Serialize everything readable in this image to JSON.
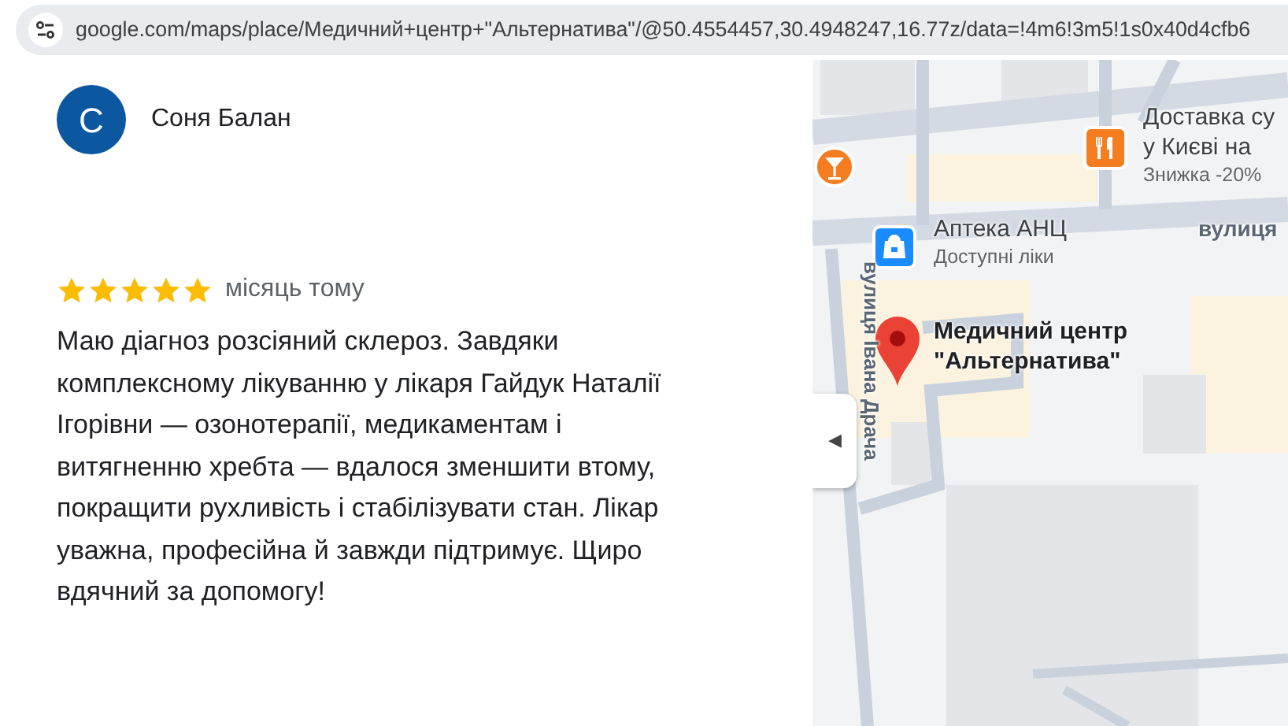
{
  "address_bar": {
    "url": "google.com/maps/place/Медичний+центр+\"Альтернатива\"/@50.4554457,30.4948247,16.77z/data=!4m6!3m5!1s0x40d4cfb6"
  },
  "review": {
    "author": {
      "initial": "С",
      "name": "Соня Балан"
    },
    "stars": 5,
    "time": "місяць тому",
    "text": "Маю діагноз розсіяний склероз. Завдяки комплексному лікуванню у лікаря Гайдук Наталії Ігорівни — озонотерапії, медикаментам і витягненню хребта — вдалося зменшити втому, покращити рухливість і стабілізувати стан. Лікар уважна, професійна й завжди підтримує. Щиро вдячний за допомогу!"
  },
  "map": {
    "markers": [
      {
        "kind": "bar"
      },
      {
        "kind": "restaurant",
        "title_lines": [
          "Доставка су",
          "у Києві на"
        ],
        "subtitle": "Знижка -20%"
      },
      {
        "kind": "pharmacy",
        "title_lines": [
          "Аптека АНЦ"
        ],
        "subtitle": "Доступні ліки"
      },
      {
        "kind": "place",
        "title_lines": [
          "Медичний центр",
          "\"Альтернатива\""
        ]
      }
    ],
    "streets": [
      {
        "kind": "horizontal",
        "label": "вулиця"
      },
      {
        "kind": "vertical",
        "label": "вулиця Івана Драча"
      }
    ],
    "collapse_button": "◀"
  }
}
